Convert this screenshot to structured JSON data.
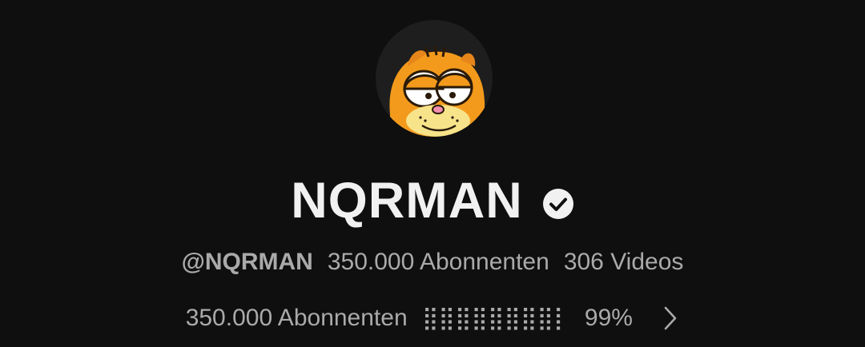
{
  "channel": {
    "name": "NQRMAN",
    "verified_icon": "verified-check-icon",
    "avatar_icon": "garfield-avatar"
  },
  "meta": {
    "handle": "@NQRMAN",
    "subscribers": "350.000 Abonnenten",
    "videos": "306 Videos"
  },
  "milestone": {
    "subscribers": "350.000 Abonnenten",
    "progress_glyphs": "⣿⣿⣿⣿⣿⣿⣿⣿⡇",
    "percent": "99%",
    "chevron_icon": "chevron-right-icon"
  },
  "colors": {
    "background": "#0f0f0f",
    "primary_text": "#f1f1f1",
    "secondary_text": "#aaaaaa",
    "avatar_orange": "#f39a1c"
  }
}
